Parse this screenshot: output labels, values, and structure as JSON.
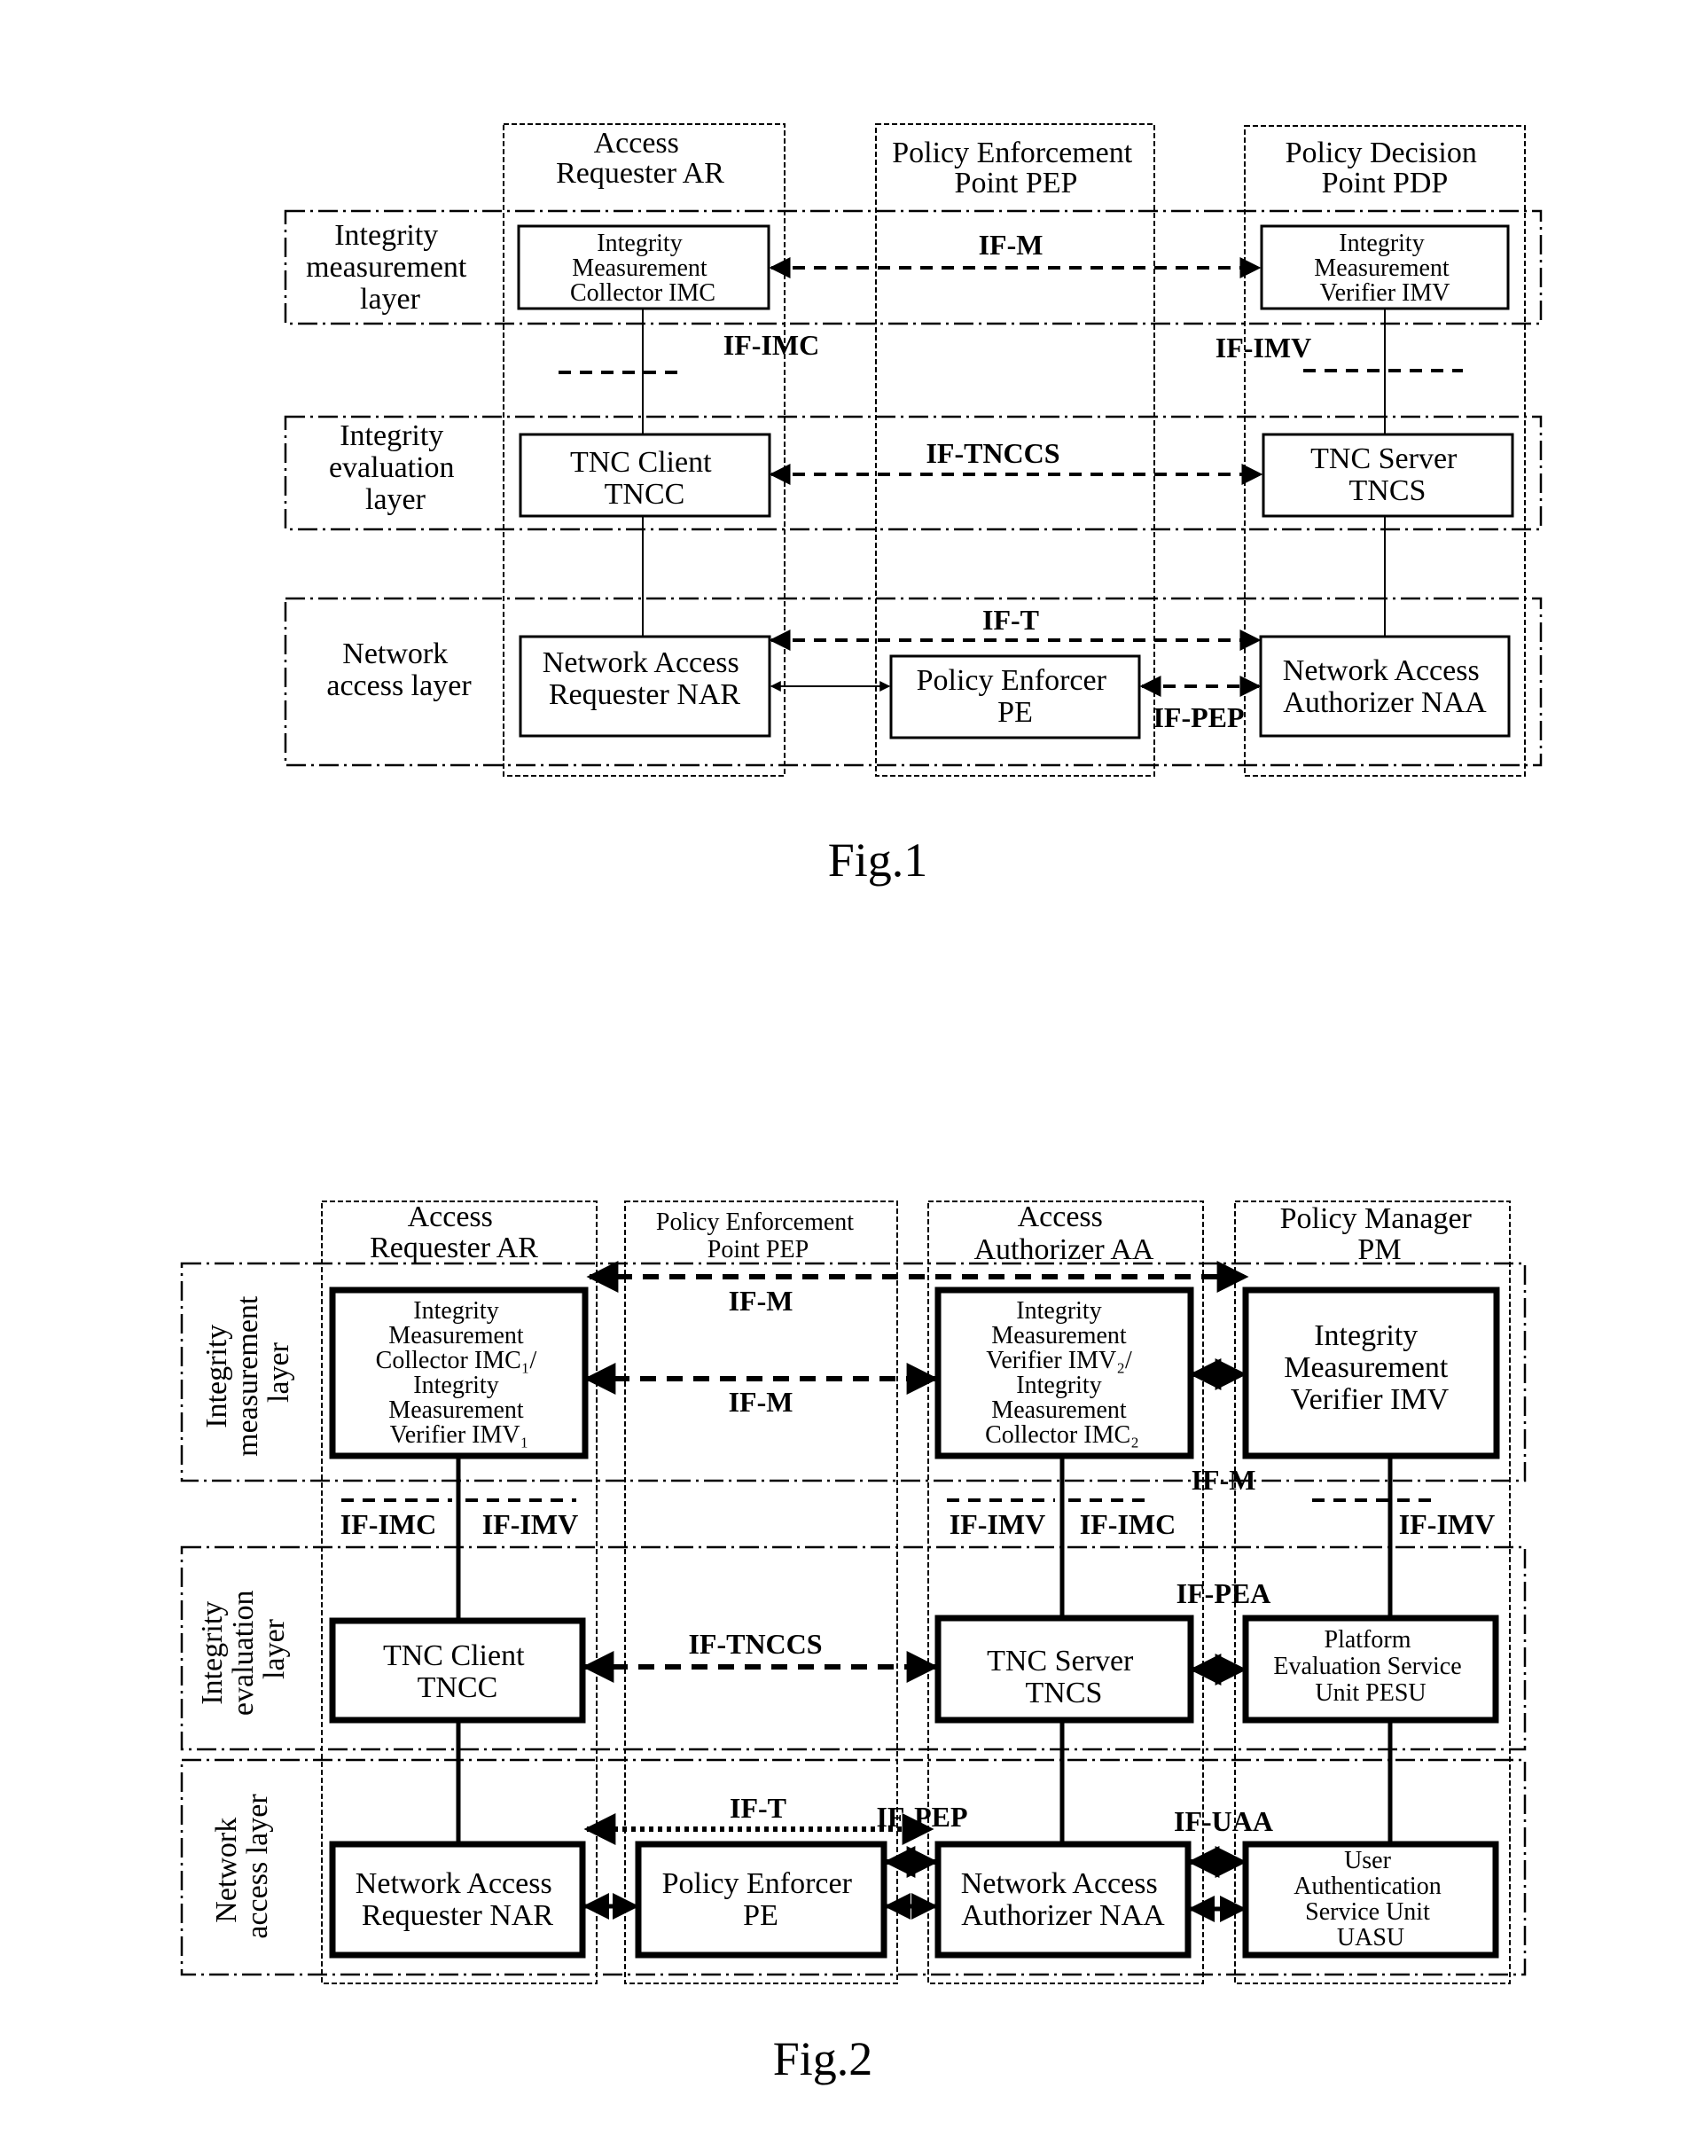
{
  "fig1": {
    "caption": "Fig.1",
    "columns": [
      {
        "id": "ar",
        "lines": [
          "Access",
          "Requester AR"
        ]
      },
      {
        "id": "pep",
        "lines": [
          "Policy Enforcement",
          "Point PEP"
        ]
      },
      {
        "id": "pdp",
        "lines": [
          "Policy Decision",
          "Point PDP"
        ]
      }
    ],
    "layers": [
      {
        "id": "iml",
        "lines": [
          "Integrity",
          "measurement",
          "layer"
        ]
      },
      {
        "id": "iel",
        "lines": [
          "Integrity",
          "evaluation",
          "layer"
        ]
      },
      {
        "id": "nal",
        "lines": [
          "Network",
          "access layer"
        ]
      }
    ],
    "boxes": {
      "imc": {
        "lines": [
          "Integrity",
          "Measurement",
          "Collector IMC"
        ]
      },
      "imv": {
        "lines": [
          "Integrity",
          "Measurement",
          "Verifier IMV"
        ]
      },
      "tncc": {
        "lines": [
          "TNC Client",
          "TNCC"
        ]
      },
      "tncs": {
        "lines": [
          "TNC Server",
          "TNCS"
        ]
      },
      "nar": {
        "lines": [
          "Network Access",
          "Requester NAR"
        ]
      },
      "pe": {
        "lines": [
          "Policy Enforcer",
          "PE"
        ]
      },
      "naa": {
        "lines": [
          "Network Access",
          "Authorizer NAA"
        ]
      }
    },
    "interfaces": {
      "if_m": "IF-M",
      "if_imc": "IF-IMC",
      "if_imv": "IF-IMV",
      "if_tnccs": "IF-TNCCS",
      "if_t": "IF-T",
      "if_pep": "IF-PEP"
    }
  },
  "fig2": {
    "caption": "Fig.2",
    "columns": [
      {
        "id": "ar",
        "lines": [
          "Access",
          "Requester AR"
        ]
      },
      {
        "id": "pep",
        "lines": [
          "Policy Enforcement",
          "Point PEP"
        ]
      },
      {
        "id": "aa",
        "lines": [
          "Access",
          "Authorizer AA"
        ]
      },
      {
        "id": "pm",
        "lines": [
          "Policy Manager",
          "PM"
        ]
      }
    ],
    "layers": [
      {
        "id": "iml",
        "lines": [
          "Integrity",
          "measurement",
          "layer"
        ]
      },
      {
        "id": "iel",
        "lines": [
          "Integrity",
          "evaluation",
          "layer"
        ]
      },
      {
        "id": "nal",
        "lines": [
          "Network",
          "access layer"
        ]
      }
    ],
    "boxes": {
      "imc1": {
        "lines": [
          "Integrity",
          "Measurement",
          "Collector IMC₁/",
          "Integrity",
          "Measurement",
          "Verifier IMV₁"
        ]
      },
      "imv2": {
        "lines": [
          "Integrity",
          "Measurement",
          "Verifier IMV₂/",
          "Integrity",
          "Measurement",
          "Collector IMC₂"
        ]
      },
      "imv": {
        "lines": [
          "Integrity",
          "Measurement",
          "Verifier IMV"
        ]
      },
      "tncc": {
        "lines": [
          "TNC Client",
          "TNCC"
        ]
      },
      "tncs": {
        "lines": [
          "TNC Server",
          "TNCS"
        ]
      },
      "pesu": {
        "lines": [
          "Platform",
          "Evaluation Service",
          "Unit PESU"
        ]
      },
      "nar": {
        "lines": [
          "Network Access",
          "Requester NAR"
        ]
      },
      "pe": {
        "lines": [
          "Policy Enforcer",
          "PE"
        ]
      },
      "naa": {
        "lines": [
          "Network Access",
          "Authorizer NAA"
        ]
      },
      "uasu": {
        "lines": [
          "User",
          "Authentication",
          "Service Unit",
          "UASU"
        ]
      }
    },
    "interfaces": {
      "if_m_top": "IF-M",
      "if_m_mid": "IF-M",
      "if_m_right": "IF-M",
      "if_imc_ar": "IF-IMC",
      "if_imv_ar": "IF-IMV",
      "if_imv_aa": "IF-IMV",
      "if_imc_aa": "IF-IMC",
      "if_imv_pm": "IF-IMV",
      "if_tnccs": "IF-TNCCS",
      "if_pea": "IF-PEA",
      "if_t": "IF-T",
      "if_pep": "IF-PEP",
      "if_uaa": "IF-UAA"
    }
  }
}
